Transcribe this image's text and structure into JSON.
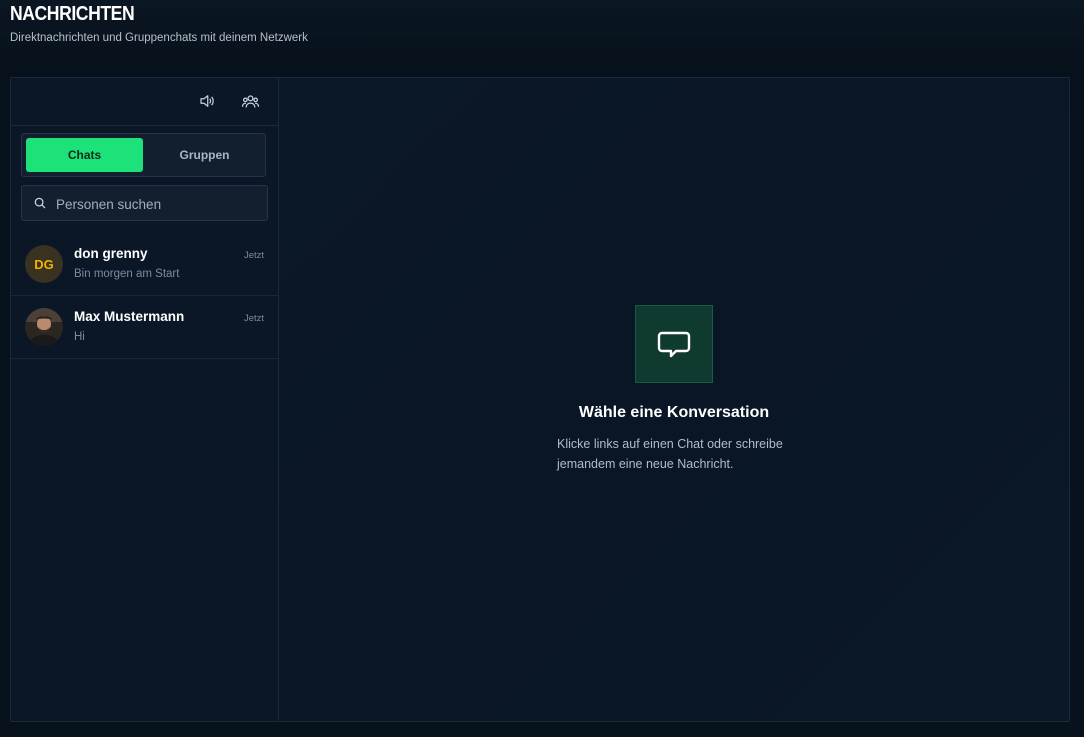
{
  "header": {
    "title": "NACHRICHTEN",
    "subtitle": "Direktnachrichten und Gruppenchats mit deinem Netzwerk"
  },
  "sidebar": {
    "toolbar": {
      "sound_icon": "speaker-icon",
      "groups_icon": "users-icon"
    },
    "tabs": [
      {
        "label": "Chats",
        "active": true
      },
      {
        "label": "Gruppen",
        "active": false
      }
    ],
    "search": {
      "placeholder": "Personen suchen",
      "value": ""
    },
    "chats": [
      {
        "name": "don grenny",
        "initials": "DG",
        "preview": "Bin morgen am Start",
        "time": "Jetzt",
        "avatar_type": "initials"
      },
      {
        "name": "Max Mustermann",
        "initials": "",
        "preview": "Hi",
        "time": "Jetzt",
        "avatar_type": "photo"
      }
    ]
  },
  "main": {
    "empty_title": "Wähle eine Konversation",
    "empty_description": "Klicke links auf einen Chat oder schreibe jemandem eine neue Nachricht.",
    "empty_icon": "chat-bubble-icon"
  },
  "colors": {
    "accent": "#1de27a",
    "background": "#07111c",
    "panel": "#0b1726",
    "initials_avatar_text": "#f0b400"
  }
}
